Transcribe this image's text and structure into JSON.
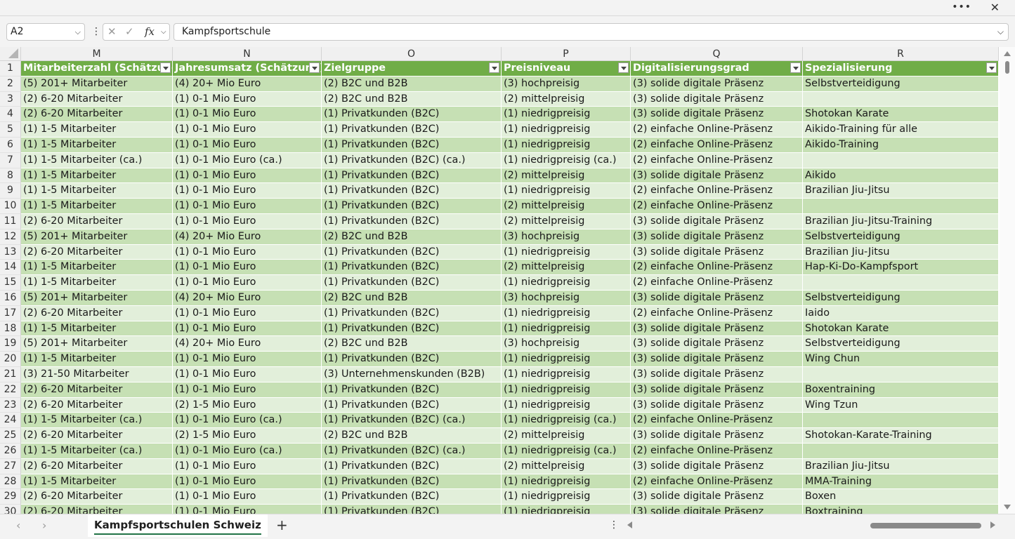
{
  "window": {
    "more_label": "•••",
    "close_label": "✕"
  },
  "formula_bar": {
    "name_box": "A2",
    "fx_label": "fx",
    "cancel_glyph": "✕",
    "enter_glyph": "✓",
    "content": "Kampfsportschule"
  },
  "columns": [
    "M",
    "N",
    "O",
    "P",
    "Q",
    "R"
  ],
  "headers": [
    "Mitarbeiterzahl (Schätzung)",
    "Jahresumsatz (Schätzung)",
    "Zielgruppe",
    "Preisniveau",
    "Digitalisierungsgrad",
    "Spezialisierung"
  ],
  "rows": [
    {
      "n": "2",
      "c": [
        "(5) 201+ Mitarbeiter",
        "(4) 20+ Mio Euro",
        "(2) B2C und B2B",
        "(3) hochpreisig",
        "(3) solide digitale Präsenz",
        "Selbstverteidigung"
      ]
    },
    {
      "n": "3",
      "c": [
        "(2) 6-20 Mitarbeiter",
        "(1) 0-1 Mio Euro",
        "(2) B2C und B2B",
        "(2) mittelpreisig",
        "(3) solide digitale Präsenz",
        ""
      ]
    },
    {
      "n": "4",
      "c": [
        "(2) 6-20 Mitarbeiter",
        "(1) 0-1 Mio Euro",
        "(1) Privatkunden (B2C)",
        "(1) niedrigpreisig",
        "(3) solide digitale Präsenz",
        "Shotokan Karate"
      ]
    },
    {
      "n": "5",
      "c": [
        "(1) 1-5 Mitarbeiter",
        "(1) 0-1 Mio Euro",
        "(1) Privatkunden (B2C)",
        "(1) niedrigpreisig",
        "(2) einfache Online-Präsenz",
        "Aikido-Training für alle"
      ]
    },
    {
      "n": "6",
      "c": [
        "(1) 1-5 Mitarbeiter",
        "(1) 0-1 Mio Euro",
        "(1) Privatkunden (B2C)",
        "(1) niedrigpreisig",
        "(2) einfache Online-Präsenz",
        "Aikido-Training"
      ]
    },
    {
      "n": "7",
      "c": [
        "(1) 1-5 Mitarbeiter (ca.)",
        "(1) 0-1 Mio Euro (ca.)",
        "(1) Privatkunden (B2C) (ca.)",
        "(1) niedrigpreisig (ca.)",
        "(2) einfache Online-Präsenz",
        ""
      ]
    },
    {
      "n": "8",
      "c": [
        "(1) 1-5 Mitarbeiter",
        "(1) 0-1 Mio Euro",
        "(1) Privatkunden (B2C)",
        "(2) mittelpreisig",
        "(3) solide digitale Präsenz",
        "Aikido"
      ]
    },
    {
      "n": "9",
      "c": [
        "(1) 1-5 Mitarbeiter",
        "(1) 0-1 Mio Euro",
        "(1) Privatkunden (B2C)",
        "(1) niedrigpreisig",
        "(2) einfache Online-Präsenz",
        "Brazilian Jiu-Jitsu"
      ]
    },
    {
      "n": "10",
      "c": [
        "(1) 1-5 Mitarbeiter",
        "(1) 0-1 Mio Euro",
        "(1) Privatkunden (B2C)",
        "(2) mittelpreisig",
        "(2) einfache Online-Präsenz",
        ""
      ]
    },
    {
      "n": "11",
      "c": [
        "(2) 6-20 Mitarbeiter",
        "(1) 0-1 Mio Euro",
        "(1) Privatkunden (B2C)",
        "(2) mittelpreisig",
        "(3) solide digitale Präsenz",
        "Brazilian Jiu-Jitsu-Training"
      ]
    },
    {
      "n": "12",
      "c": [
        "(5) 201+ Mitarbeiter",
        "(4) 20+ Mio Euro",
        "(2) B2C und B2B",
        "(3) hochpreisig",
        "(3) solide digitale Präsenz",
        "Selbstverteidigung"
      ]
    },
    {
      "n": "13",
      "c": [
        "(2) 6-20 Mitarbeiter",
        "(1) 0-1 Mio Euro",
        "(1) Privatkunden (B2C)",
        "(1) niedrigpreisig",
        "(3) solide digitale Präsenz",
        "Brazilian Jiu-Jitsu"
      ]
    },
    {
      "n": "14",
      "c": [
        "(1) 1-5 Mitarbeiter",
        "(1) 0-1 Mio Euro",
        "(1) Privatkunden (B2C)",
        "(2) mittelpreisig",
        "(2) einfache Online-Präsenz",
        "Hap-Ki-Do-Kampfsport"
      ]
    },
    {
      "n": "15",
      "c": [
        "(1) 1-5 Mitarbeiter",
        "(1) 0-1 Mio Euro",
        "(1) Privatkunden (B2C)",
        "(1) niedrigpreisig",
        "(2) einfache Online-Präsenz",
        ""
      ]
    },
    {
      "n": "16",
      "c": [
        "(5) 201+ Mitarbeiter",
        "(4) 20+ Mio Euro",
        "(2) B2C und B2B",
        "(3) hochpreisig",
        "(3) solide digitale Präsenz",
        "Selbstverteidigung"
      ]
    },
    {
      "n": "17",
      "c": [
        "(2) 6-20 Mitarbeiter",
        "(1) 0-1 Mio Euro",
        "(1) Privatkunden (B2C)",
        "(1) niedrigpreisig",
        "(2) einfache Online-Präsenz",
        "Iaido"
      ]
    },
    {
      "n": "18",
      "c": [
        "(1) 1-5 Mitarbeiter",
        "(1) 0-1 Mio Euro",
        "(1) Privatkunden (B2C)",
        "(1) niedrigpreisig",
        "(3) solide digitale Präsenz",
        "Shotokan Karate"
      ]
    },
    {
      "n": "19",
      "c": [
        "(5) 201+ Mitarbeiter",
        "(4) 20+ Mio Euro",
        "(2) B2C und B2B",
        "(3) hochpreisig",
        "(3) solide digitale Präsenz",
        "Selbstverteidigung"
      ]
    },
    {
      "n": "20",
      "c": [
        "(1) 1-5 Mitarbeiter",
        "(1) 0-1 Mio Euro",
        "(1) Privatkunden (B2C)",
        "(1) niedrigpreisig",
        "(3) solide digitale Präsenz",
        "Wing Chun"
      ]
    },
    {
      "n": "21",
      "c": [
        "(3) 21-50 Mitarbeiter",
        "(1) 0-1 Mio Euro",
        "(3) Unternehmenskunden (B2B)",
        "(1) niedrigpreisig",
        "(3) solide digitale Präsenz",
        ""
      ]
    },
    {
      "n": "22",
      "c": [
        "(2) 6-20 Mitarbeiter",
        "(1) 0-1 Mio Euro",
        "(1) Privatkunden (B2C)",
        "(1) niedrigpreisig",
        "(3) solide digitale Präsenz",
        "Boxentraining"
      ]
    },
    {
      "n": "23",
      "c": [
        "(2) 6-20 Mitarbeiter",
        "(2) 1-5 Mio Euro",
        "(1) Privatkunden (B2C)",
        "(1) niedrigpreisig",
        "(3) solide digitale Präsenz",
        "Wing Tzun"
      ]
    },
    {
      "n": "24",
      "c": [
        "(1) 1-5 Mitarbeiter (ca.)",
        "(1) 0-1 Mio Euro (ca.)",
        "(1) Privatkunden (B2C) (ca.)",
        "(1) niedrigpreisig (ca.)",
        "(2) einfache Online-Präsenz",
        ""
      ]
    },
    {
      "n": "25",
      "c": [
        "(2) 6-20 Mitarbeiter",
        "(2) 1-5 Mio Euro",
        "(2) B2C und B2B",
        "(2) mittelpreisig",
        "(3) solide digitale Präsenz",
        "Shotokan-Karate-Training"
      ]
    },
    {
      "n": "26",
      "c": [
        "(1) 1-5 Mitarbeiter (ca.)",
        "(1) 0-1 Mio Euro (ca.)",
        "(1) Privatkunden (B2C) (ca.)",
        "(1) niedrigpreisig (ca.)",
        "(2) einfache Online-Präsenz",
        ""
      ]
    },
    {
      "n": "27",
      "c": [
        "(2) 6-20 Mitarbeiter",
        "(1) 0-1 Mio Euro",
        "(1) Privatkunden (B2C)",
        "(2) mittelpreisig",
        "(3) solide digitale Präsenz",
        "Brazilian Jiu-Jitsu"
      ]
    },
    {
      "n": "28",
      "c": [
        "(1) 1-5 Mitarbeiter",
        "(1) 0-1 Mio Euro",
        "(1) Privatkunden (B2C)",
        "(1) niedrigpreisig",
        "(2) einfache Online-Präsenz",
        "MMA-Training"
      ]
    },
    {
      "n": "29",
      "c": [
        "(2) 6-20 Mitarbeiter",
        "(1) 0-1 Mio Euro",
        "(1) Privatkunden (B2C)",
        "(1) niedrigpreisig",
        "(3) solide digitale Präsenz",
        "Boxen"
      ]
    },
    {
      "n": "30",
      "c": [
        "(2) 6-20 Mitarbeiter",
        "(1) 0-1 Mio Euro",
        "(1) Privatkunden (B2C)",
        "(1) niedrigpreisig",
        "(3) solide digitale Präsenz",
        "Boxtraining"
      ]
    }
  ],
  "sheet_tabs": {
    "active": "Kampfsportschulen Schweiz",
    "add_label": "+"
  }
}
